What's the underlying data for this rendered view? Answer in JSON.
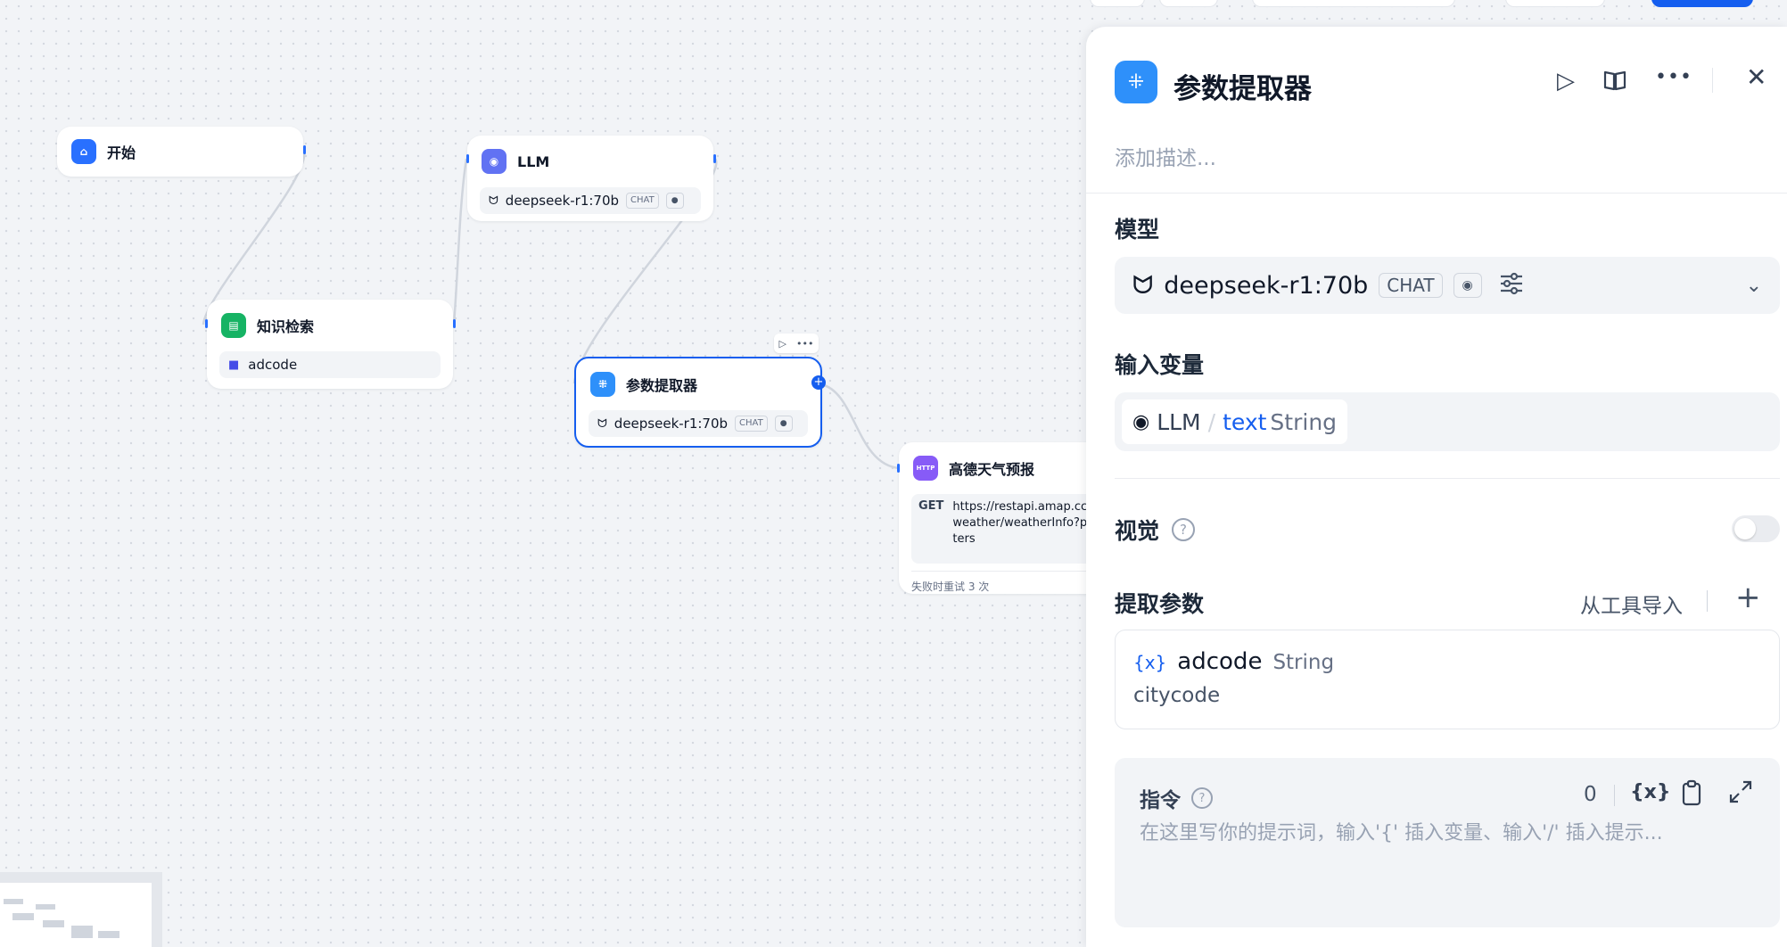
{
  "canvas": {
    "nodes": {
      "start": {
        "title": "开始"
      },
      "llm": {
        "title": "LLM",
        "model": "deepseek-r1:70b",
        "tag": "CHAT"
      },
      "knowledge": {
        "title": "知识检索",
        "dataset": "adcode"
      },
      "extractor": {
        "title": "参数提取器",
        "model": "deepseek-r1:70b",
        "tag": "CHAT"
      },
      "http": {
        "title": "高德天气预报",
        "method": "GET",
        "icon_label": "HTTP",
        "url_lines": [
          "https://restapi.amap.cc",
          "weather/weatherInfo?p",
          "ters"
        ],
        "retry": "失败时重试 3 次"
      }
    }
  },
  "panel": {
    "title": "参数提取器",
    "description_placeholder": "添加描述...",
    "model_section": {
      "label": "模型",
      "model": "deepseek-r1:70b",
      "tag": "CHAT"
    },
    "input_section": {
      "label": "输入变量",
      "node": "LLM",
      "separator": "/",
      "var": "text",
      "type": "String"
    },
    "vision": {
      "label": "视觉",
      "enabled": false
    },
    "params": {
      "label": "提取参数",
      "import_label": "从工具导入",
      "add_symbol": "+",
      "items": [
        {
          "name": "adcode",
          "type": "String",
          "description": "citycode"
        }
      ]
    },
    "instruction": {
      "label": "指令",
      "count": "0",
      "var_symbol": "{x}",
      "placeholder": "在这里写你的提示词，输入'{' 插入变量、输入'/' 插入提示..."
    }
  },
  "colors": {
    "accent": "#155eef",
    "start_icon": "#2970ff",
    "llm_icon": "#6172f3",
    "knowledge_icon": "#16b364",
    "extractor_icon": "#2e90fa",
    "http_icon": "#875bf7"
  }
}
